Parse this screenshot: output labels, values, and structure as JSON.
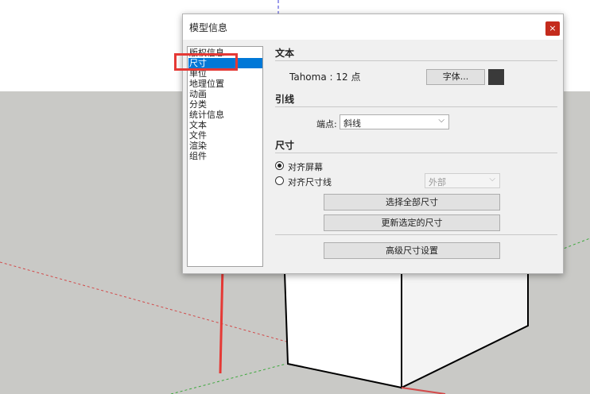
{
  "dialog": {
    "title": "模型信息",
    "close_glyph": "×",
    "categories": [
      {
        "label": "版权信息",
        "selected": false
      },
      {
        "label": "尺寸",
        "selected": true
      },
      {
        "label": "单位",
        "selected": false
      },
      {
        "label": "地理位置",
        "selected": false
      },
      {
        "label": "动画",
        "selected": false
      },
      {
        "label": "分类",
        "selected": false
      },
      {
        "label": "统计信息",
        "selected": false
      },
      {
        "label": "文本",
        "selected": false
      },
      {
        "label": "文件",
        "selected": false
      },
      {
        "label": "渲染",
        "selected": false
      },
      {
        "label": "组件",
        "selected": false
      }
    ],
    "text_section": {
      "heading": "文本",
      "font_desc": "Tahoma : 12 点",
      "font_button": "字体...",
      "color_swatch": "#3a3a3a"
    },
    "leader_section": {
      "heading": "引线",
      "endpoint_label": "端点:",
      "endpoint_value": "斜线"
    },
    "dimension_section": {
      "heading": "尺寸",
      "align_screen": "对齐屏幕",
      "align_dim_line": "对齐尺寸线",
      "align_screen_checked": true,
      "position_value": "外部",
      "select_all_button": "选择全部尺寸",
      "update_selected_button": "更新选定的尺寸",
      "advanced_button": "高级尺寸设置"
    }
  },
  "colors": {
    "selection": "#0078d7",
    "annotation": "#e53935",
    "close_button": "#c42b1c"
  }
}
